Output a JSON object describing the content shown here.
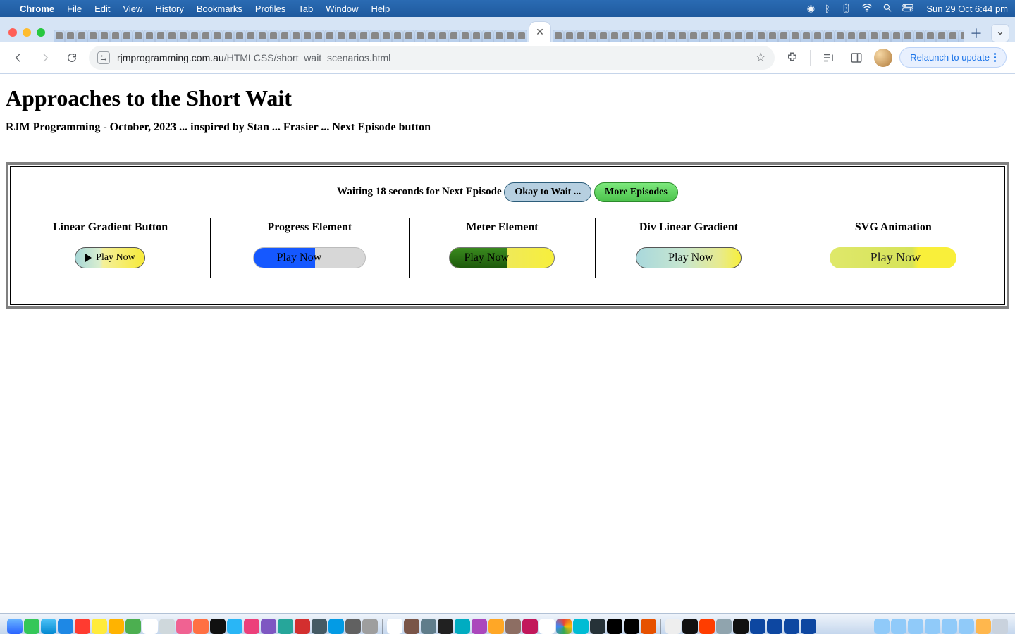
{
  "menubar": {
    "app": "Chrome",
    "items": [
      "File",
      "Edit",
      "View",
      "History",
      "Bookmarks",
      "Profiles",
      "Tab",
      "Window",
      "Help"
    ],
    "clock": "Sun 29 Oct  6:44 pm"
  },
  "browser": {
    "url_host": "rjmprogramming.com.au",
    "url_path": "/HTMLCSS/short_wait_scenarios.html",
    "relaunch": "Relaunch to update"
  },
  "page": {
    "title": "Approaches to the Short Wait",
    "subtitle": "RJM Programming - October, 2023 ... inspired by Stan ... Frasier ... Next Episode button",
    "wait_line": "Waiting 18 seconds for Next Episode",
    "btn_wait": "Okay to Wait ...",
    "btn_more": "More Episodes",
    "cols": {
      "c1": "Linear Gradient Button",
      "c2": "Progress Element",
      "c3": "Meter Element",
      "c4": "Div Linear Gradient",
      "c5": "SVG Animation"
    },
    "play": "Play Now"
  }
}
